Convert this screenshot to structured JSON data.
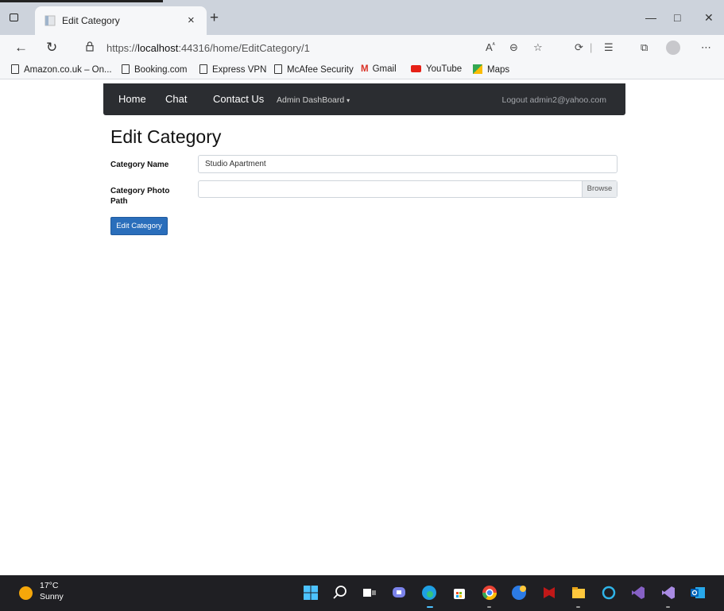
{
  "browser": {
    "tab_title": "Edit Category",
    "new_tab": "+",
    "close_tab": "×",
    "url_prefix": "https://",
    "url_host": "localhost",
    "url_rest": ":44316/home/EditCategory/1",
    "minimize": "—",
    "maximize": "□",
    "close_window": "✕"
  },
  "bookmarks": [
    {
      "label": "Amazon.co.uk – On...",
      "icon": "page-icon"
    },
    {
      "label": "Booking.com",
      "icon": "page-icon"
    },
    {
      "label": "Express VPN",
      "icon": "page-icon"
    },
    {
      "label": "McAfee Security",
      "icon": "page-icon"
    },
    {
      "label": "Gmail",
      "icon": "gmail-icon"
    },
    {
      "label": "YouTube",
      "icon": "youtube-icon"
    },
    {
      "label": "Maps",
      "icon": "maps-icon"
    }
  ],
  "navbar": {
    "home": "Home",
    "chat": "Chat",
    "contact": "Contact Us",
    "admin": "Admin DashBoard",
    "logout": "Logout admin2@yahoo.com"
  },
  "page": {
    "title": "Edit Category",
    "name_label": "Category Name",
    "name_value": "Studio Apartment",
    "photo_label_line1": "Category Photo",
    "photo_label_line2": "Path",
    "browse": "Browse",
    "submit": "Edit Category"
  },
  "taskbar": {
    "temperature": "17°C",
    "condition": "Sunny"
  },
  "colors": {
    "navbar_bg": "#2b2d31",
    "primary_button": "#2a6ebb",
    "taskbar_bg": "#1f1f23"
  }
}
